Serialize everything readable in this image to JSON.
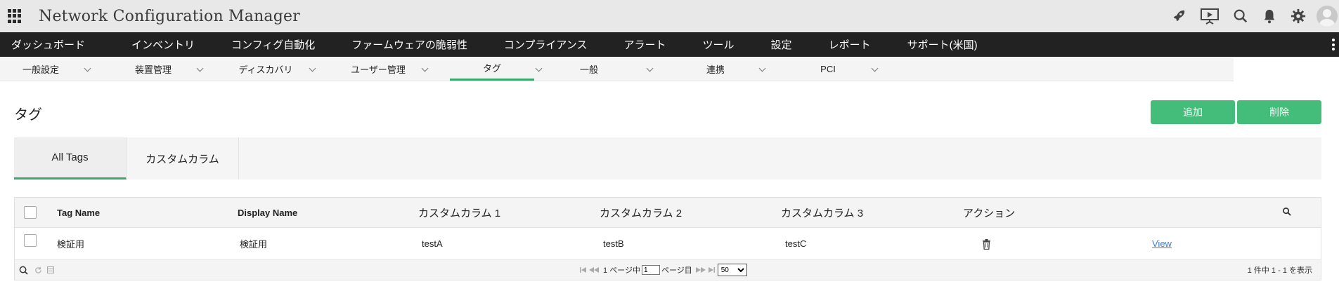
{
  "app": {
    "title": "Network Configuration Manager"
  },
  "main_nav": [
    "ダッシュボード",
    "インベントリ",
    "コンフィグ自動化",
    "ファームウェアの脆弱性",
    "コンプライアンス",
    "アラート",
    "ツール",
    "設定",
    "レポート",
    "サポート(米国)"
  ],
  "sub_nav": [
    {
      "label": "一般設定",
      "active": false
    },
    {
      "label": "装置管理",
      "active": false
    },
    {
      "label": "ディスカバリ",
      "active": false
    },
    {
      "label": "ユーザー管理",
      "active": false
    },
    {
      "label": "タグ",
      "active": true
    },
    {
      "label": "一般",
      "active": false
    },
    {
      "label": "連携",
      "active": false
    },
    {
      "label": "PCI",
      "active": false
    }
  ],
  "page": {
    "title": "タグ",
    "add_button": "追加",
    "delete_button": "削除"
  },
  "tabs": [
    {
      "label": "All Tags",
      "active": true
    },
    {
      "label": "カスタムカラム",
      "active": false
    }
  ],
  "table": {
    "columns": [
      "Tag Name",
      "Display Name",
      "カスタムカラム 1",
      "カスタムカラム 2",
      "カスタムカラム 3",
      "アクション"
    ],
    "rows": [
      {
        "tag_name": "検証用",
        "display_name": "検証用",
        "c1": "testA",
        "c2": "testB",
        "c3": "testC",
        "view": "View"
      }
    ]
  },
  "pagination": {
    "page_label_before": "1 ページ中",
    "page_value": "1",
    "page_label_after": "ページ目",
    "page_size": "50",
    "summary": "1 件中 1 - 1 を表示"
  },
  "colors": {
    "accent": "#45bd7a",
    "nav_bg": "#222222",
    "link": "#3b7dd8"
  }
}
